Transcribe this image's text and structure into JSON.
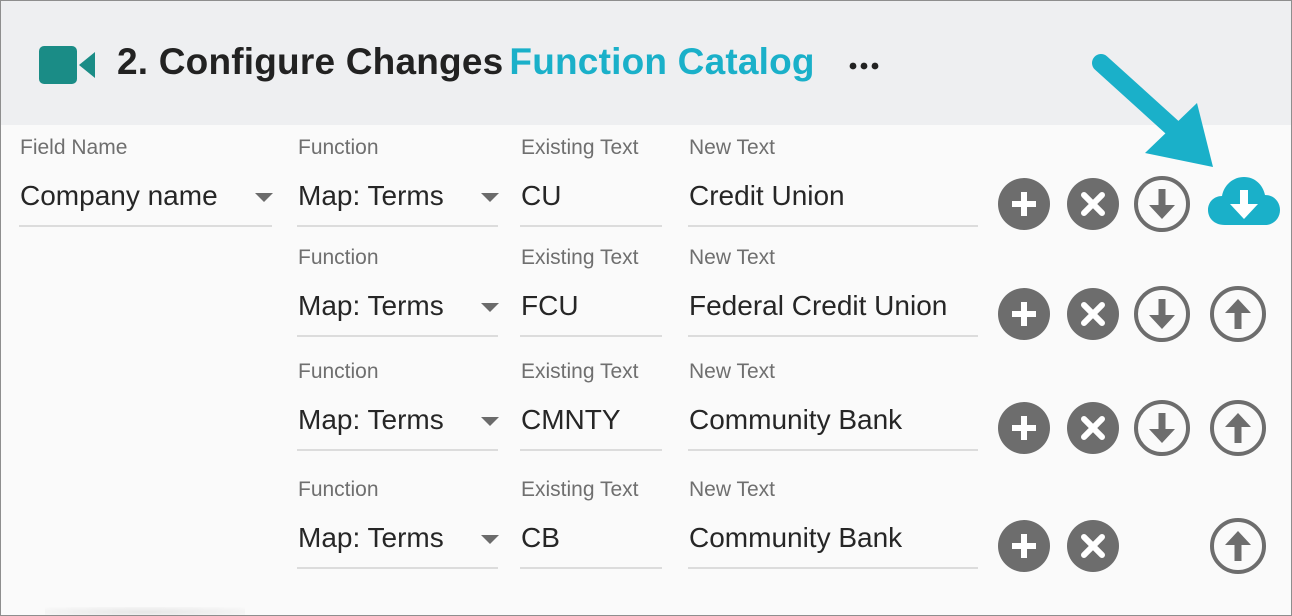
{
  "header": {
    "icon": "video-camera-icon",
    "title": "2. Configure Changes",
    "subtitle": "Function Catalog",
    "more_icon": "more-horizontal-icon"
  },
  "colors": {
    "accent": "#1ab0c9",
    "camera": "#1a8c86",
    "button_gray": "#6d6d6d",
    "header_bg": "#eeeff1"
  },
  "field": {
    "label": "Field Name",
    "value": "Company name"
  },
  "rows": [
    {
      "function_label": "Function",
      "function_value": "Map: Terms",
      "existing_label": "Existing Text",
      "existing_value": "CU",
      "new_label": "New Text",
      "new_value": "Credit Union",
      "buttons": [
        "add-icon",
        "remove-icon",
        "move-down-icon",
        "cloud-download-icon"
      ]
    },
    {
      "function_label": "Function",
      "function_value": "Map: Terms",
      "existing_label": "Existing Text",
      "existing_value": "FCU",
      "new_label": "New Text",
      "new_value": "Federal Credit Union",
      "buttons": [
        "add-icon",
        "remove-icon",
        "move-down-icon",
        "move-up-icon"
      ]
    },
    {
      "function_label": "Function",
      "function_value": "Map: Terms",
      "existing_label": "Existing Text",
      "existing_value": "CMNTY",
      "new_label": "New Text",
      "new_value": "Community Bank",
      "buttons": [
        "add-icon",
        "remove-icon",
        "move-down-icon",
        "move-up-icon"
      ]
    },
    {
      "function_label": "Function",
      "function_value": "Map: Terms",
      "existing_label": "Existing Text",
      "existing_value": "CB",
      "new_label": "New Text",
      "new_value": "Community Bank",
      "buttons": [
        "add-icon",
        "remove-icon",
        "move-up-icon"
      ]
    }
  ]
}
